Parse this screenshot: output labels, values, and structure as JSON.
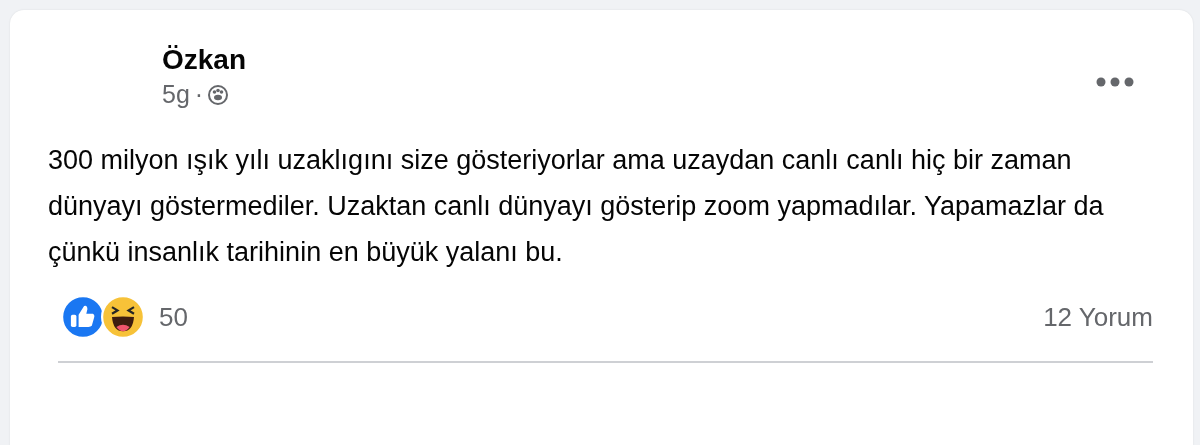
{
  "post": {
    "author": "Özkan",
    "time": "5g",
    "separator": "·",
    "text": "300 milyon ışık yılı uzaklıgını size gösteriyorlar ama uzaydan canlı canlı hiç bir zaman dünyayı göstermediler. Uzaktan canlı dünyayı gösterip zoom yapmadılar. Yapamazlar da çünkü insanlık tarihinin en büyük yalanı bu.",
    "reactions": [
      {
        "kind": "like"
      },
      {
        "kind": "haha"
      }
    ],
    "reaction_count": "50",
    "comments": "12 Yorum"
  }
}
